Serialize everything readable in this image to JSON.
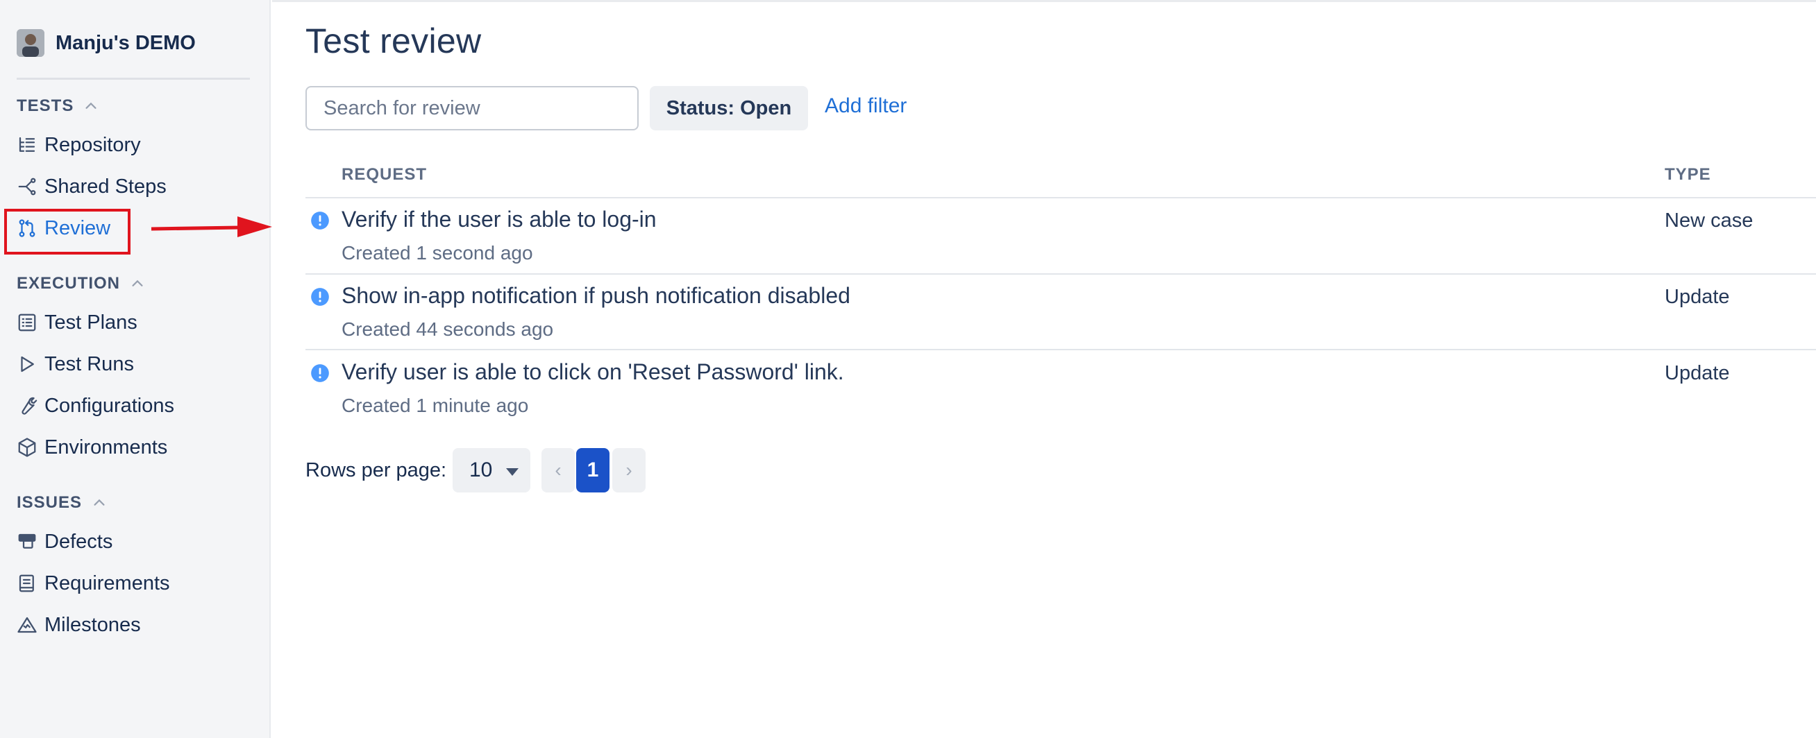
{
  "sidebar": {
    "project_name": "Manju's DEMO",
    "sections": [
      {
        "title": "TESTS",
        "items": [
          "Repository",
          "Shared Steps",
          "Review"
        ]
      },
      {
        "title": "EXECUTION",
        "items": [
          "Test Plans",
          "Test Runs",
          "Configurations",
          "Environments"
        ]
      },
      {
        "title": "ISSUES",
        "items": [
          "Defects",
          "Requirements",
          "Milestones"
        ]
      }
    ],
    "active_item": "Review"
  },
  "main": {
    "title": "Test review",
    "search_placeholder": "Search for review",
    "status_filter": "Status: Open",
    "add_filter_label": "Add filter",
    "columns": {
      "request": "REQUEST",
      "type": "TYPE"
    },
    "rows": [
      {
        "title": "Verify if the user is able to log-in",
        "created": "Created 1 second ago",
        "type": "New case"
      },
      {
        "title": "Show in-app notification if push notification disabled",
        "created": "Created 44 seconds ago",
        "type": "Update"
      },
      {
        "title": "Verify user is able to click on 'Reset Password' link.",
        "created": "Created 1 minute ago",
        "type": "Update"
      }
    ],
    "pagination": {
      "rows_per_page_label": "Rows per page:",
      "rows_per_page": "10",
      "prev": "‹",
      "current_page": "1",
      "next": "›"
    }
  },
  "colors": {
    "accent": "#1f6fd6",
    "active_page": "#1b52c8",
    "annotation": "#e0141e",
    "row_icon": "#4c9aff"
  },
  "icons": {
    "repository": "hierarchy-list-icon",
    "shared_steps": "branch-share-icon",
    "review": "git-pull-request-icon",
    "test_plans": "list-icon",
    "test_runs": "play-icon",
    "configurations": "wrench-icon",
    "environments": "cube-icon",
    "defects": "defect-icon",
    "requirements": "book-icon",
    "milestones": "mountain-icon",
    "row_status": "info-circle-icon"
  }
}
